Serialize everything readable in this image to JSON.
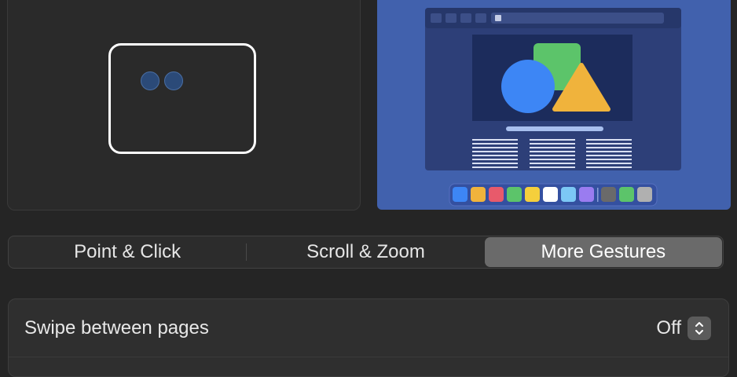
{
  "tabs": [
    {
      "label": "Point & Click",
      "selected": false
    },
    {
      "label": "Scroll & Zoom",
      "selected": false
    },
    {
      "label": "More Gestures",
      "selected": true
    }
  ],
  "settings": {
    "swipe_between_pages": {
      "label": "Swipe between pages",
      "value": "Off"
    }
  },
  "preview": {
    "background_color": "#4161ad",
    "dock_colors": [
      "#3d86f5",
      "#f0b33c",
      "#e85a6b",
      "#5cc46a",
      "#f5cf3c",
      "#ffffff",
      "#7cc8f5",
      "#9a7cf0",
      "#6a6a6a",
      "#5cc46a",
      "#b0b0b0"
    ]
  }
}
